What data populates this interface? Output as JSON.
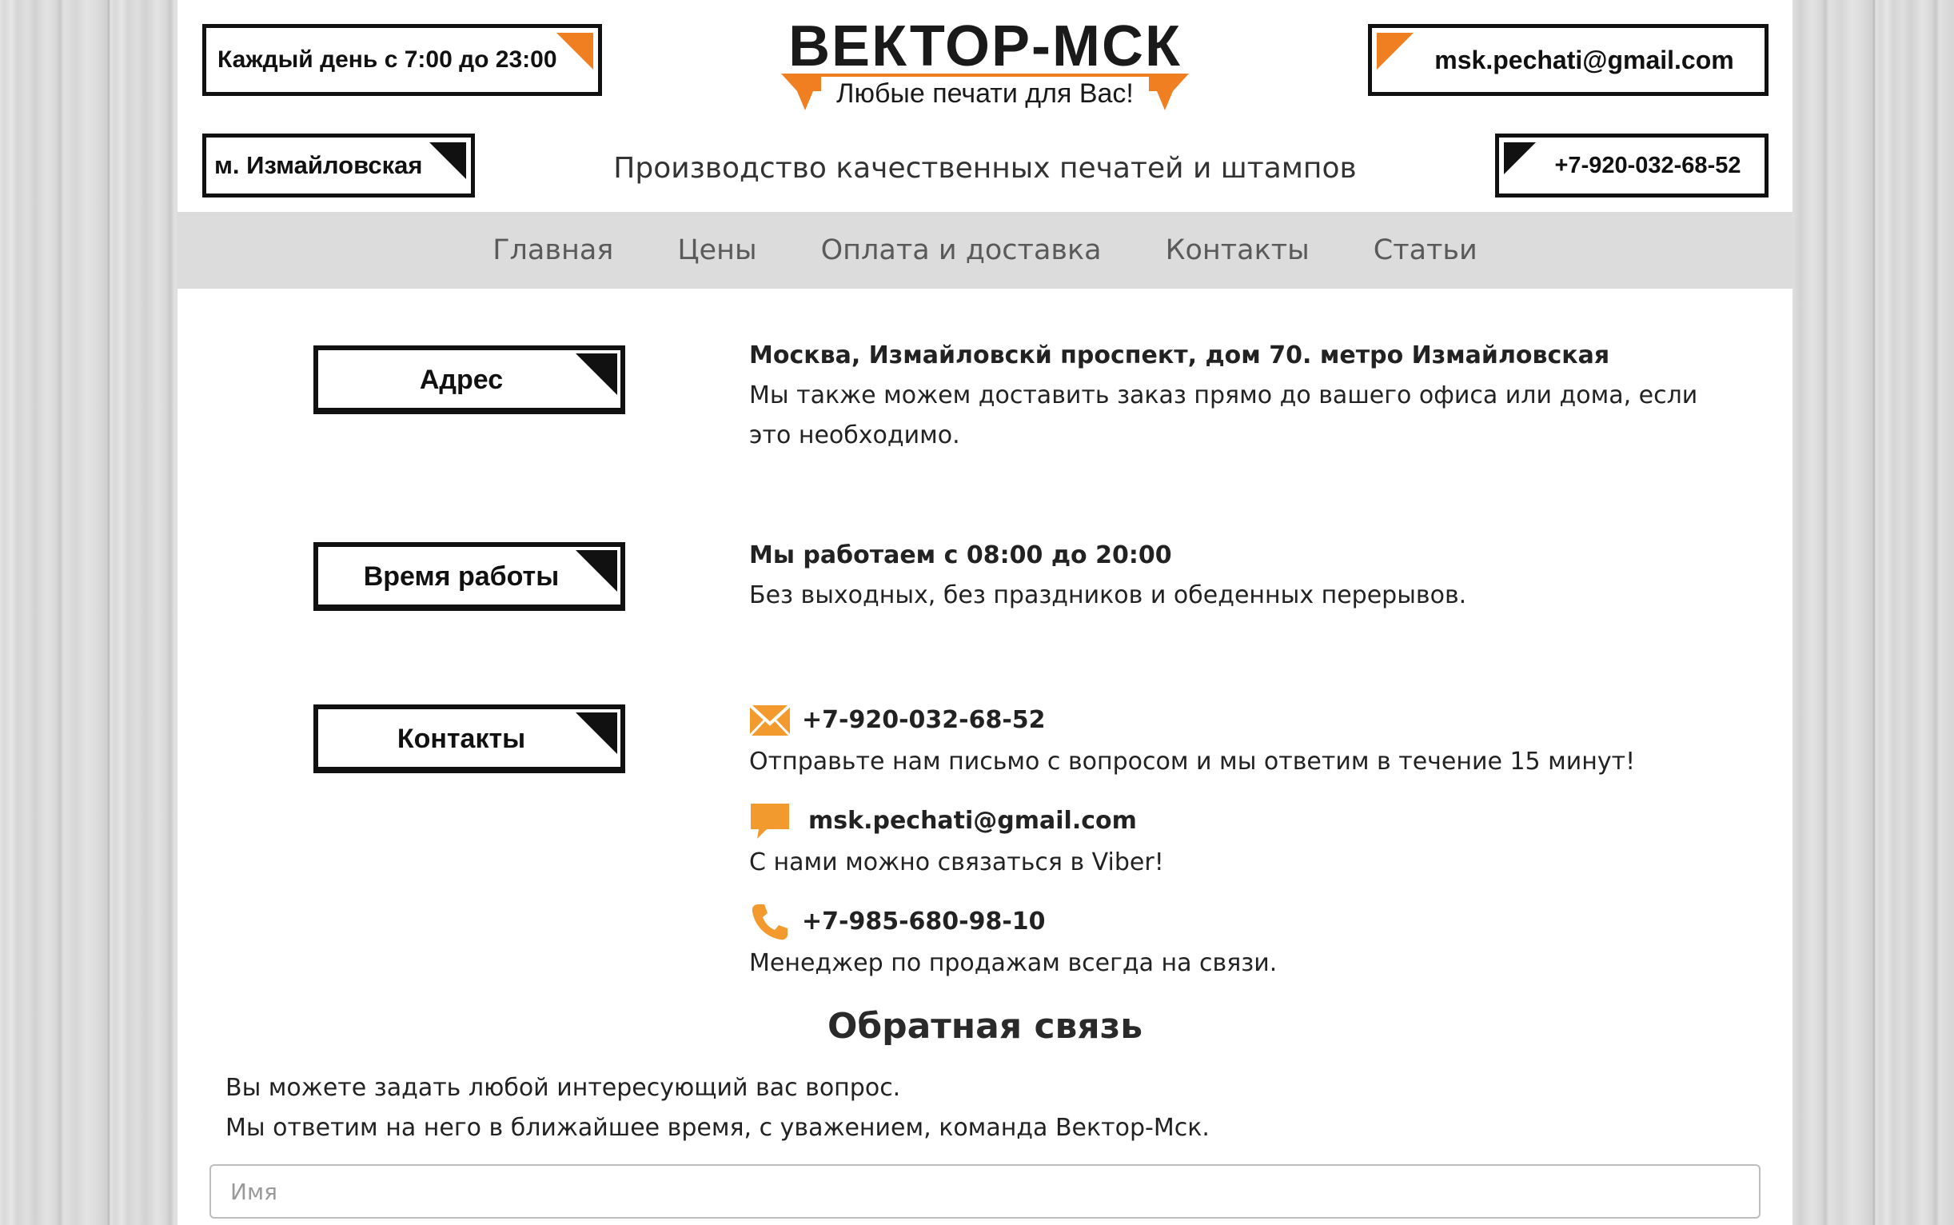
{
  "header": {
    "hours": "Каждый день с 7:00 до 23:00",
    "email": "msk.pechati@gmail.com",
    "metro": "м. Измайловская",
    "phone": "+7-920-032-68-52",
    "logo_title": "ВЕКТОР-МСК",
    "logo_tagline": "Любые печати для Вас!",
    "subtitle": "Производство качественных печатей и штампов"
  },
  "nav": {
    "items": [
      {
        "label": "Главная"
      },
      {
        "label": "Цены"
      },
      {
        "label": "Оплата и доставка"
      },
      {
        "label": "Контакты"
      },
      {
        "label": "Статьи"
      }
    ]
  },
  "sections": {
    "address": {
      "label": "Адрес",
      "heading": "Москва, Измайловскй проспект, дом 70. метро Измайловская",
      "text": "Мы также можем доставить заказ прямо до вашего офиса или дома, если это необходимо."
    },
    "hours": {
      "label": "Время работы",
      "heading": "Мы работаем с 08:00 до 20:00",
      "text": "Без выходных, без праздников и обеденных перерывов."
    },
    "contacts": {
      "label": "Контакты",
      "items": [
        {
          "icon": "envelope-icon",
          "value": "+7-920-032-68-52",
          "text": "Отправьте нам письмо с вопросом и мы ответим в течение 15 минут!"
        },
        {
          "icon": "chat-bubble-icon",
          "value": "msk.pechati@gmail.com",
          "text": "С нами можно связаться в Viber!"
        },
        {
          "icon": "phone-icon",
          "value": "+7-985-680-98-10",
          "text": "Менеджер по продажам всегда на связи."
        }
      ]
    }
  },
  "feedback": {
    "title": "Обратная связь",
    "line1": "Вы можете задать любой интересующий вас вопрос.",
    "line2": "Мы ответим на него в ближайшее время, с уважением, команда Вектор-Мск.",
    "name_placeholder": "Имя"
  },
  "colors": {
    "accent": "#f07f22",
    "nav_bg": "#dcdcdc",
    "text": "#222222"
  }
}
